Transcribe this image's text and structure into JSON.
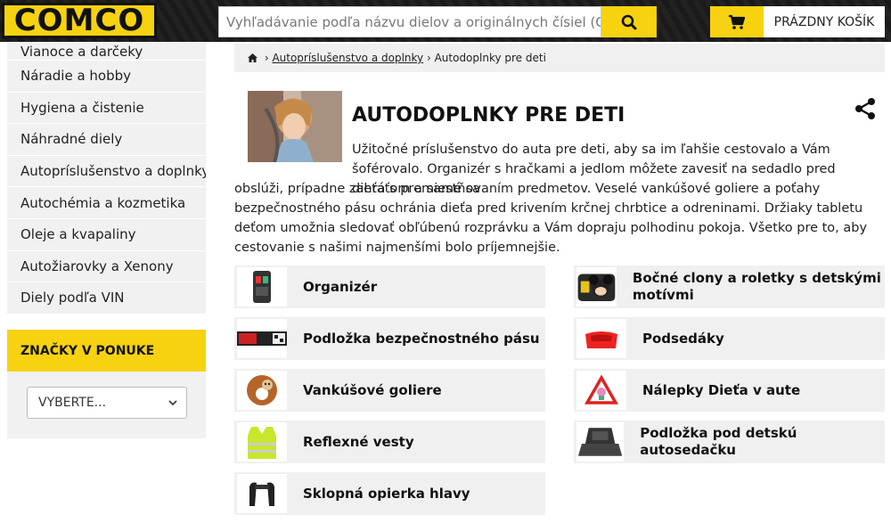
{
  "header": {
    "logo_text": "COMCO",
    "search_placeholder": "Vyhľadávanie podľa názvu dielov a originálnych čísiel (OEM)",
    "cart_label": "PRÁZDNY KOŠÍK"
  },
  "sidebar": {
    "items": [
      {
        "label": "Vianoce a darčeky"
      },
      {
        "label": "Náradie a hobby"
      },
      {
        "label": "Hygiena a čistenie"
      },
      {
        "label": "Náhradné diely"
      },
      {
        "label": "Autopríslušenstvo a doplnky"
      },
      {
        "label": "Autochémia a kozmetika"
      },
      {
        "label": "Oleje a kvapaliny"
      },
      {
        "label": "Autožiarovky a Xenony"
      },
      {
        "label": "Diely podľa VIN"
      }
    ],
    "brands_title": "ZNAČKY V PONUKE",
    "brands_select": "VYBERTE..."
  },
  "breadcrumb": {
    "link": "Autopríslušenstvo a doplnky",
    "current": "Autodoplnky pre deti"
  },
  "category": {
    "title": "AUTODOPLNKY PRE DETI",
    "desc_top": "Užitočné príslušenstvo do auta pre deti, aby sa im ľahšie cestovalo a Vám šoférovalo. Organizér s hračkami a jedlom môžete zavesiť na sedadlo pred dieťaťom a samé sa",
    "desc_bottom": "obslúži, prípadne zahrá s premiestňovaním predmetov. Veselé vankúšové goliere a poťahy bezpečnostného pásu ochránia dieťa pred krivením krčnej chrbtice a odreninami. Držiaky tabletu deťom umožnia sledovať obľúbenú rozprávku a Vám dopraju polhodinu pokoja. Všetko pre to, aby cestovanie s našimi najmenšími bolo príjemnejšie."
  },
  "subcategories": [
    {
      "label": "Organizér"
    },
    {
      "label": "Bočné clony a roletky s detskými motívmi"
    },
    {
      "label": "Podložka bezpečnostného pásu"
    },
    {
      "label": "Podsedáky"
    },
    {
      "label": "Vankúšové goliere"
    },
    {
      "label": "Nálepky Dieťa v aute"
    },
    {
      "label": "Reflexné vesty"
    },
    {
      "label": "Podložka pod detskú autosedačku"
    },
    {
      "label": "Sklopná opierka hlavy"
    }
  ],
  "colors": {
    "accent": "#f6d210",
    "header_bg": "#1b1b1b",
    "panel": "#f0f0f0"
  }
}
